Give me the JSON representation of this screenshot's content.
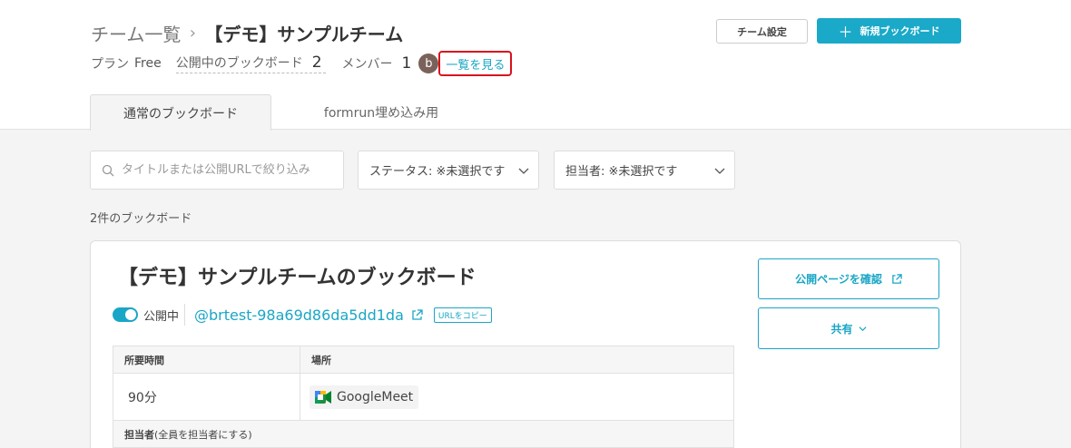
{
  "breadcrumb": {
    "parent": "チーム一覧",
    "current": "【デモ】サンプルチーム"
  },
  "meta": {
    "plan_label": "プラン",
    "plan_value": "Free",
    "public_label": "公開中のブックボード",
    "public_count": "2",
    "members_label": "メンバー",
    "members_count": "1",
    "avatar_letter": "b",
    "view_list": "一覧を見る"
  },
  "header_actions": {
    "team_settings": "チーム設定",
    "new_bookboard": "新規ブックボード"
  },
  "tabs": [
    {
      "label": "通常のブックボード",
      "active": true
    },
    {
      "label": "formrun埋め込み用",
      "active": false
    }
  ],
  "filters": {
    "search_placeholder": "タイトルまたは公開URLで絞り込み",
    "status": "ステータス: ※未選択です",
    "owner": "担当者: ※未選択です"
  },
  "count_text": "2件のブックボード",
  "card": {
    "title": "【デモ】サンプルチームのブックボード",
    "public_label": "公開中",
    "slug": "@brtest-98a69d86da5dd1da",
    "copy_url": "URLをコピー",
    "public_page_button": "公開ページを確認",
    "share_button": "共有",
    "table": {
      "col_duration": "所要時間",
      "col_place": "場所",
      "duration": "90分",
      "place": "GoogleMeet",
      "owner_header_bold": "担当者",
      "owner_header_note": "(全員を担当者にする)"
    }
  },
  "colors": {
    "accent": "#1aa6c6",
    "highlight": "#d8121e"
  }
}
